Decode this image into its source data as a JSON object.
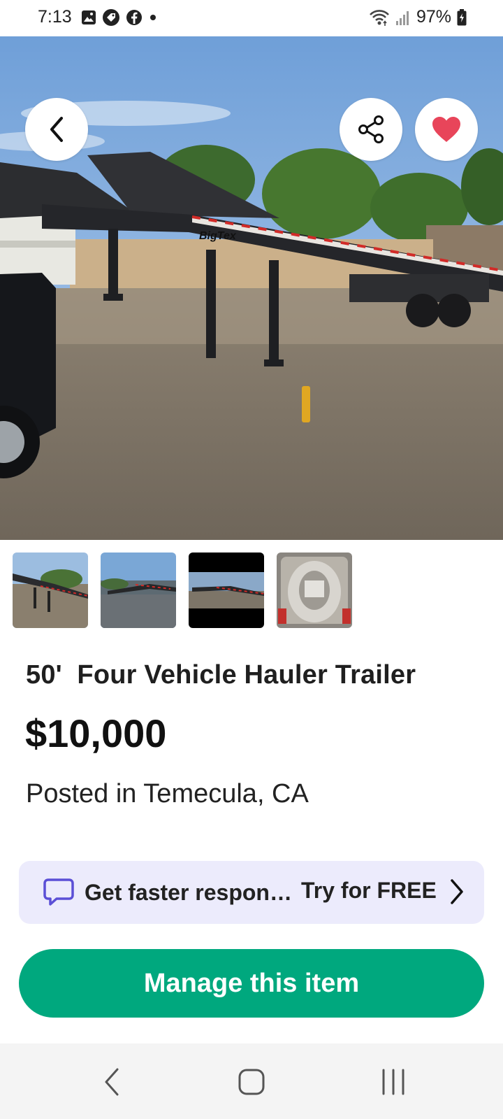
{
  "status_bar": {
    "time": "7:13",
    "battery": "97%",
    "icons": [
      "gallery-icon",
      "tag-icon",
      "facebook-icon",
      "dot-icon",
      "wifi-icon",
      "signal-icon",
      "battery-icon"
    ]
  },
  "hero": {
    "image_label": "BigTex",
    "back_icon": "chevron-left-icon",
    "share_icon": "share-icon",
    "favorite_icon": "heart-icon",
    "favorite_color": "#e8455a"
  },
  "thumbnails": [
    {
      "name": "thumb-1"
    },
    {
      "name": "thumb-2"
    },
    {
      "name": "thumb-3"
    },
    {
      "name": "thumb-4"
    }
  ],
  "listing": {
    "title": "50'  Four Vehicle Hauler Trailer",
    "price": "$10,000",
    "location": "Posted in Temecula, CA"
  },
  "promo": {
    "text": "Get faster respon…",
    "cta": "Try for FREE",
    "icon": "chat-bubble-icon",
    "accent": "#5b4fd6"
  },
  "actions": {
    "manage_label": "Manage this item",
    "manage_color": "#00a87e"
  },
  "nav": {
    "icons": [
      "back-icon",
      "home-icon",
      "recents-icon"
    ]
  }
}
